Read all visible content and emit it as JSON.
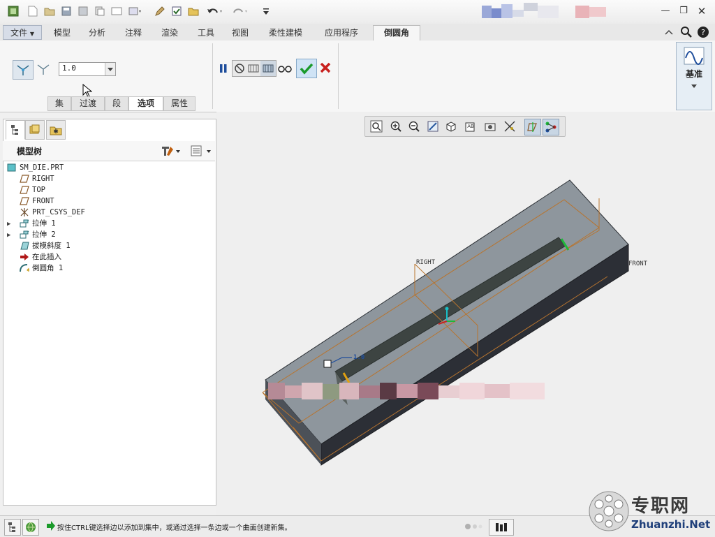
{
  "ribbon_tabs": {
    "file": "文件",
    "items": [
      "模型",
      "分析",
      "注释",
      "渲染",
      "工具",
      "视图",
      "柔性建模",
      "应用程序"
    ],
    "active": "倒圆角"
  },
  "ribbon": {
    "radius_value": "1.0",
    "subtabs": [
      "集",
      "过渡",
      "段",
      "选项",
      "属性"
    ],
    "selected_subtab": "选项",
    "datum_label": "基准"
  },
  "model_tree": {
    "title": "模型树",
    "items": [
      {
        "label": "SM_DIE.PRT",
        "icon": "part-icon"
      },
      {
        "label": "RIGHT",
        "icon": "datum-plane-icon"
      },
      {
        "label": "TOP",
        "icon": "datum-plane-icon"
      },
      {
        "label": "FRONT",
        "icon": "datum-plane-icon"
      },
      {
        "label": "PRT_CSYS_DEF",
        "icon": "csys-icon"
      },
      {
        "label": "拉伸 1",
        "icon": "extrude-icon"
      },
      {
        "label": "拉伸 2",
        "icon": "extrude-icon"
      },
      {
        "label": "拔模斜度 1",
        "icon": "draft-icon"
      },
      {
        "label": "在此插入",
        "icon": "insert-arrow-icon"
      },
      {
        "label": "倒圆角 1",
        "icon": "round-icon"
      }
    ]
  },
  "viewport_labels": {
    "right": "RIGHT",
    "front": "FRONT",
    "dimension": "1.0"
  },
  "status": {
    "message": "按住CTRL键选择边以添加到集中，或通过选择一条边或一个曲面创建新集。"
  },
  "watermark": {
    "brand": "专职网",
    "url": "Zhuanzhi.Net"
  },
  "colors": {
    "accent_blue": "#1f4e9c",
    "ok_green": "#1a9a2a",
    "cancel_red": "#c8201e",
    "datum_orange": "#b8742e"
  }
}
